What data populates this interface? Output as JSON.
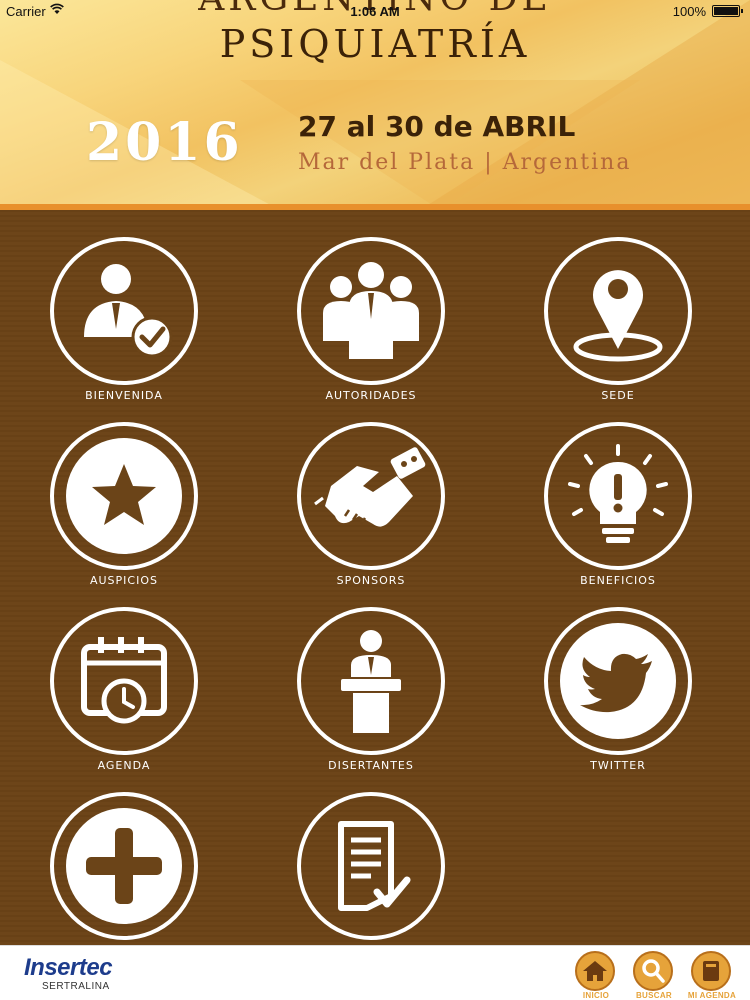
{
  "status_bar": {
    "carrier": "Carrier",
    "time": "1:06 AM",
    "battery": "100%"
  },
  "header": {
    "title_line1": "ARGENTINO DE",
    "title_line2": "PSIQUIATRÍA",
    "year": "2016",
    "dates": "27 al 30 de ABRIL",
    "place": "Mar del Plata | Argentina",
    "accent_color": "#e8902c"
  },
  "menu": {
    "items": [
      {
        "label": "BIENVENIDA",
        "icon": "person-check-icon"
      },
      {
        "label": "AUTORIDADES",
        "icon": "people-group-icon"
      },
      {
        "label": "SEDE",
        "icon": "location-pin-icon"
      },
      {
        "label": "AUSPICIOS",
        "icon": "star-icon"
      },
      {
        "label": "SPONSORS",
        "icon": "handshake-icon"
      },
      {
        "label": "BENEFICIOS",
        "icon": "lightbulb-icon"
      },
      {
        "label": "AGENDA",
        "icon": "calendar-clock-icon"
      },
      {
        "label": "DISERTANTES",
        "icon": "speaker-podium-icon"
      },
      {
        "label": "TWITTER",
        "icon": "twitter-bird-icon"
      },
      {
        "label": "",
        "icon": "plus-icon"
      },
      {
        "label": "",
        "icon": "document-check-icon"
      }
    ]
  },
  "footer": {
    "brand": "Insertec",
    "brand_sub": "SERTRALINA",
    "nav": [
      {
        "label": "INICIO",
        "icon": "home-icon"
      },
      {
        "label": "BUSCAR",
        "icon": "search-icon"
      },
      {
        "label": "MI AGENDA",
        "icon": "book-icon"
      }
    ]
  },
  "colors": {
    "background": "#6b4418",
    "icon_white": "#ffffff",
    "nav_orange": "#e6a33a"
  }
}
